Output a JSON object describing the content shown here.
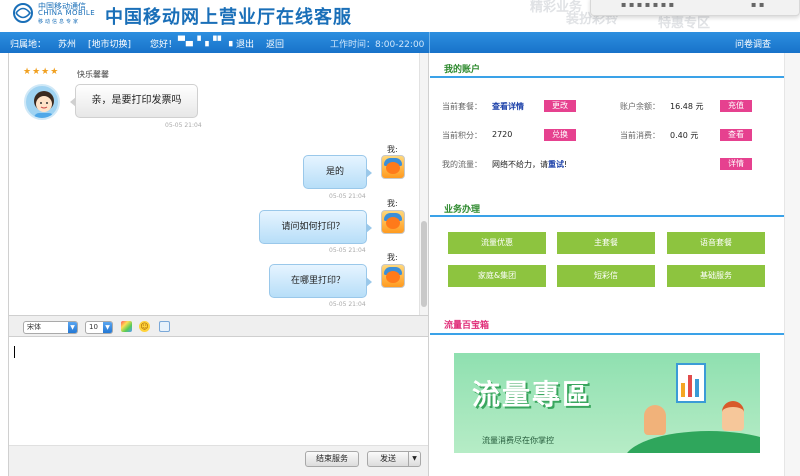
{
  "header": {
    "logo_cn": "中国移动通信",
    "logo_en": "CHINA MOBILE",
    "logo_slogan": "移动信息专家",
    "title": "中国移动网上营业厅在线客服",
    "ghost_texts": [
      "精彩业务",
      "装扮彩铃",
      "特惠专区"
    ]
  },
  "bluebar": {
    "location_label": "归属地：",
    "location_value": "苏州",
    "city_switch": "[地市切换]",
    "greeting": "您好！",
    "username_masked": "▀▄▝▗▝▘▗",
    "logout": "退出",
    "back": "返回",
    "work_time": "工作时间：8:00-22:00",
    "survey": "问卷调查"
  },
  "chat": {
    "stars": "★★★★",
    "agent_name": "快乐馨馨",
    "messages": [
      {
        "from": "agent",
        "text": "亲，是要打印发票吗",
        "time": "05-05 21:04"
      },
      {
        "from": "me",
        "label": "我:",
        "text": "是的",
        "time": "05-05 21:04"
      },
      {
        "from": "me",
        "label": "我:",
        "text": "请问如何打印？",
        "time": "05-05 21:04"
      },
      {
        "from": "me",
        "label": "我:",
        "text": "在哪里打印？",
        "time": "05-05 21:04"
      }
    ]
  },
  "toolbar": {
    "font_family": "宋体",
    "font_size": "10"
  },
  "footer": {
    "end_service": "结束服务",
    "send": "发送",
    "send_arrow": "▼"
  },
  "account": {
    "section_title": "我的账户",
    "current_plan_label": "当前套餐：",
    "current_plan_link": "查看详情",
    "change_btn": "更改",
    "balance_label": "账户余额：",
    "balance_value": "16.48 元",
    "recharge_btn": "充值",
    "points_label": "当前积分：",
    "points_value": "2720",
    "redeem_btn": "兑换",
    "spend_label": "当前消费：",
    "spend_value": "0.40 元",
    "view_btn": "查看",
    "data_label": "我的流量：",
    "data_value_prefix": "网络不给力，请",
    "data_retry": "重试",
    "data_value_suffix": "!",
    "details_btn": "详情"
  },
  "business": {
    "section_title": "业务办理",
    "buttons": [
      "流量优惠",
      "主套餐",
      "语音套餐",
      "家庭&集团",
      "短彩信",
      "基础服务"
    ]
  },
  "treasure": {
    "section_title": "流量百宝箱",
    "banner_title": "流量專區",
    "banner_sub": "流量消费尽在你掌控"
  },
  "colors": {
    "brand_blue": "#1a6fb8",
    "bar_blue": "#1872c9",
    "section_green": "#2e8a2e",
    "button_pink": "#e6418f",
    "biz_green": "#8dc43f"
  }
}
